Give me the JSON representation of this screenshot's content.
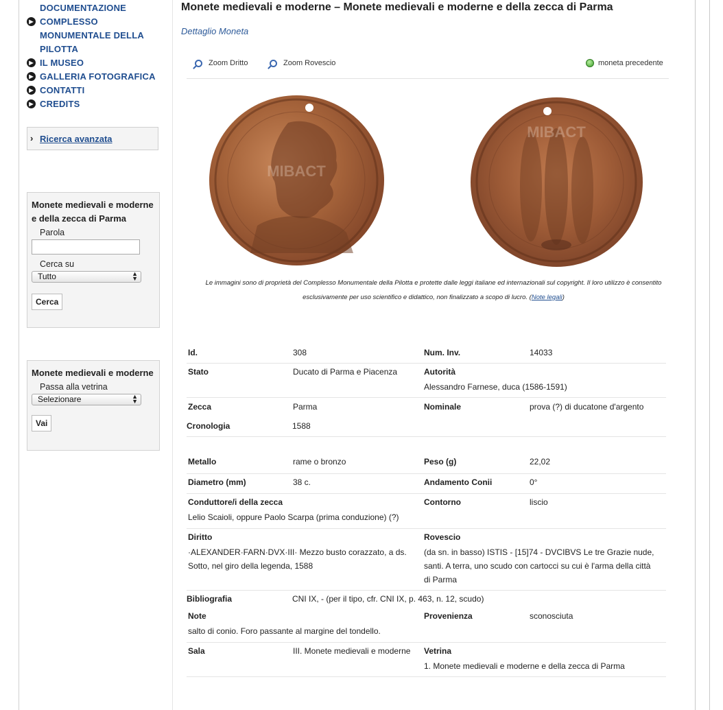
{
  "sidebar": {
    "nav": [
      {
        "label": "DOCUMENTAZIONE",
        "bullet": false
      },
      {
        "label": "COMPLESSO MONUMENTALE DELLA PILOTTA",
        "bullet": true
      },
      {
        "label": "IL MUSEO",
        "bullet": true
      },
      {
        "label": "GALLERIA FOTOGRAFICA",
        "bullet": true
      },
      {
        "label": "CONTATTI",
        "bullet": true
      },
      {
        "label": "CREDITS",
        "bullet": true
      }
    ],
    "advanced_search": "Ricerca avanzata",
    "search_box": {
      "title": "Monete medievali e moderne e della zecca di Parma",
      "word_label": "Parola",
      "word_value": "",
      "search_in_label": "Cerca su",
      "search_in_value": "Tutto",
      "button": "Cerca"
    },
    "showcase_box": {
      "title": "Monete medievali e moderne",
      "goto_label": "Passa alla vetrina",
      "select_value": "Selezionare",
      "button": "Vai"
    }
  },
  "main": {
    "title": "Monete medievali e moderne – Monete medievali e moderne e della zecca di Parma",
    "subtitle": "Dettaglio Moneta",
    "toolbar": {
      "zoom_obverse": "Zoom Dritto",
      "zoom_reverse": "Zoom Rovescio",
      "previous": "moneta precedente"
    },
    "copyright_text": "Le immagini sono di proprietà del Complesso Monumentale della Pilotta e protette dalle leggi italiane ed internazionali sul copyright. Il loro utilizzo è consentito esclusivamente per uso scientifico e didattico, non finalizzato a scopo di lucro. (",
    "copyright_link": "Note legali",
    "copyright_end": ")",
    "watermark": "MIBACT",
    "details": {
      "id_label": "Id.",
      "id_value": "308",
      "inv_label": "Num. Inv.",
      "inv_value": "14033",
      "stato_label": "Stato",
      "stato_value": "Ducato di Parma e Piacenza",
      "autorita_label": "Autorità",
      "autorita_value": "Alessandro Farnese, duca (1586-1591)",
      "zecca_label": "Zecca",
      "zecca_value": "Parma",
      "nominale_label": "Nominale",
      "nominale_value": "prova (?) di ducatone d'argento",
      "cronologia_label": "Cronologia",
      "cronologia_value": "1588",
      "metallo_label": "Metallo",
      "metallo_value": "rame o bronzo",
      "peso_label": "Peso (g)",
      "peso_value": "22,02",
      "diametro_label": "Diametro (mm)",
      "diametro_value": "38 c.",
      "conii_label": "Andamento Conii",
      "conii_value": "0°",
      "conduttore_label": "Conduttore/i della zecca",
      "conduttore_value": "Lelio Scaioli, oppure Paolo Scarpa (prima conduzione) (?)",
      "contorno_label": "Contorno",
      "contorno_value": "liscio",
      "diritto_label": "Diritto",
      "diritto_value": "·ALEXANDER·FARN·DVX·III· Mezzo busto corazzato, a ds. Sotto, nel giro della legenda, 1588",
      "rovescio_label": "Rovescio",
      "rovescio_value": "(da sn. in basso) ISTIS - [15]74 - DVCIBVS Le tre Grazie nude, santi. A terra, uno scudo con cartocci su cui è l'arma della città di Parma",
      "bibliografia_label": "Bibliografia",
      "bibliografia_value": "CNI IX, - (per il tipo, cfr. CNI IX, p. 463, n. 12, scudo)",
      "note_label": "Note",
      "note_value": "salto di conio. Foro passante al margine del tondello.",
      "provenienza_label": "Provenienza",
      "provenienza_value": "sconosciuta",
      "sala_label": "Sala",
      "sala_value": "III. Monete medievali e moderne",
      "vetrina_label": "Vetrina",
      "vetrina_value": "1. Monete medievali e moderne e della zecca di Parma"
    }
  },
  "colors": {
    "link_blue": "#1f4d8f",
    "subtitle_blue": "#2d5a99",
    "coin_bronze": "#9c5a36"
  }
}
